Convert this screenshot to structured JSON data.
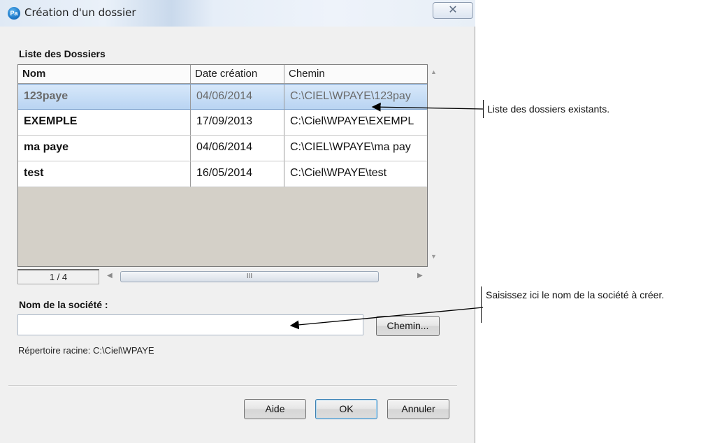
{
  "window": {
    "title": "Création d'un dossier",
    "app_icon_text": "Pa",
    "close_glyph": "✕"
  },
  "list": {
    "section_label": "Liste des Dossiers",
    "columns": [
      "Nom",
      "Date création",
      "Chemin"
    ],
    "rows": [
      {
        "nom": "123paye",
        "date": "04/06/2014",
        "chemin": "C:\\CIEL\\WPAYE\\123pay",
        "selected": true
      },
      {
        "nom": "EXEMPLE",
        "date": "17/09/2013",
        "chemin": "C:\\Ciel\\WPAYE\\EXEMPL",
        "selected": false
      },
      {
        "nom": "ma paye",
        "date": "04/06/2014",
        "chemin": "C:\\CIEL\\WPAYE\\ma pay",
        "selected": false
      },
      {
        "nom": "test",
        "date": "16/05/2014",
        "chemin": "C:\\Ciel\\WPAYE\\test",
        "selected": false
      }
    ],
    "page_counter": "1 / 4",
    "hscroll_grip": "III"
  },
  "company": {
    "label": "Nom de la société :",
    "value": "",
    "chemin_button": "Chemin..."
  },
  "root_dir": "Répertoire racine: C:\\Ciel\\WPAYE",
  "buttons": {
    "aide": "Aide",
    "ok": "OK",
    "annuler": "Annuler"
  },
  "callouts": {
    "list_note": "Liste des dossiers existants.",
    "company_note": "Saisissez ici le nom de la société à créer."
  },
  "colors": {
    "selected_row": "#c5dcf5",
    "list_empty_area": "#d4d0c8",
    "dialog_background": "#f0f0f0"
  }
}
